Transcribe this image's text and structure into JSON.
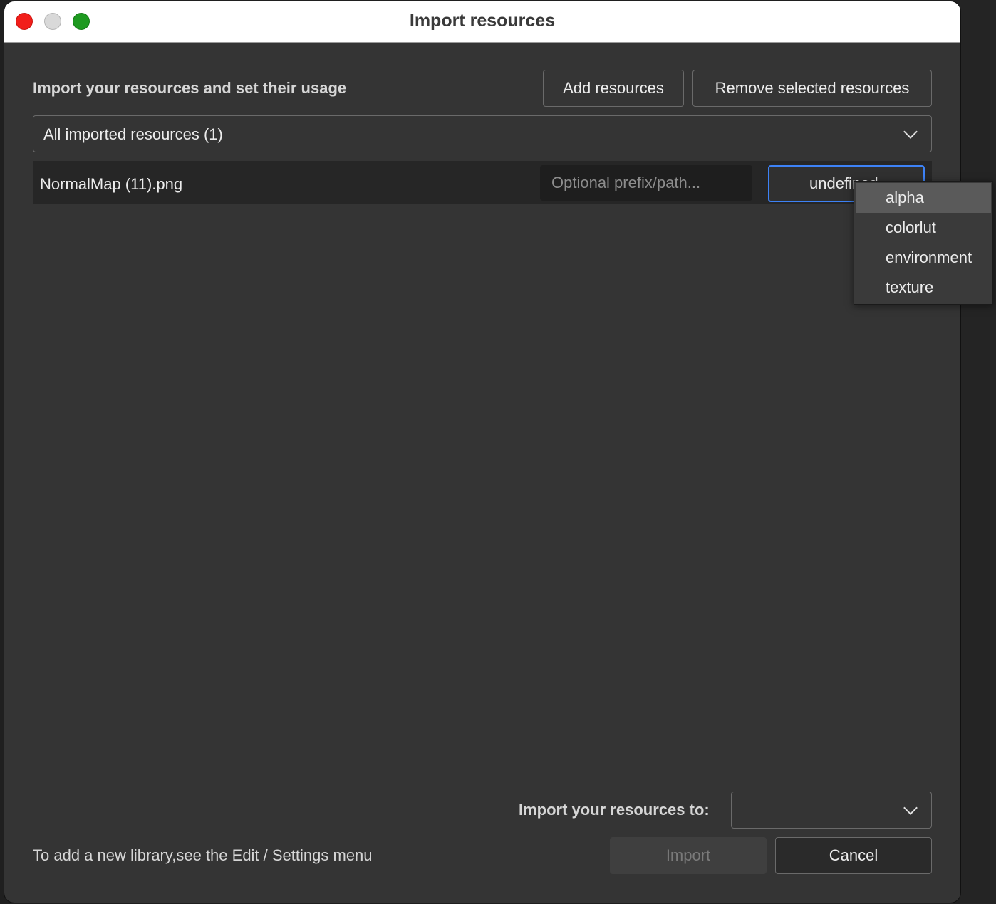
{
  "window": {
    "title": "Import resources"
  },
  "header": {
    "heading": "Import your resources and set their usage",
    "add_label": "Add resources",
    "remove_label": "Remove selected resources"
  },
  "filter": {
    "selected": "All imported resources (1)"
  },
  "resources": [
    {
      "filename": "NormalMap (11).png",
      "prefix_placeholder": "Optional prefix/path...",
      "prefix_value": "",
      "usage": "undefined"
    }
  ],
  "usage_menu": {
    "options": [
      "alpha",
      "colorlut",
      "environment",
      "texture"
    ],
    "highlighted": "alpha"
  },
  "destination": {
    "label": "Import your resources to:",
    "selected": ""
  },
  "footer": {
    "note": "To add a new library,see the Edit / Settings menu",
    "import_label": "Import",
    "cancel_label": "Cancel"
  },
  "colors": {
    "accent": "#3d82f6",
    "close": "#f21e1a",
    "minimize": "#d9d9d9",
    "maximize": "#1e9a20"
  }
}
